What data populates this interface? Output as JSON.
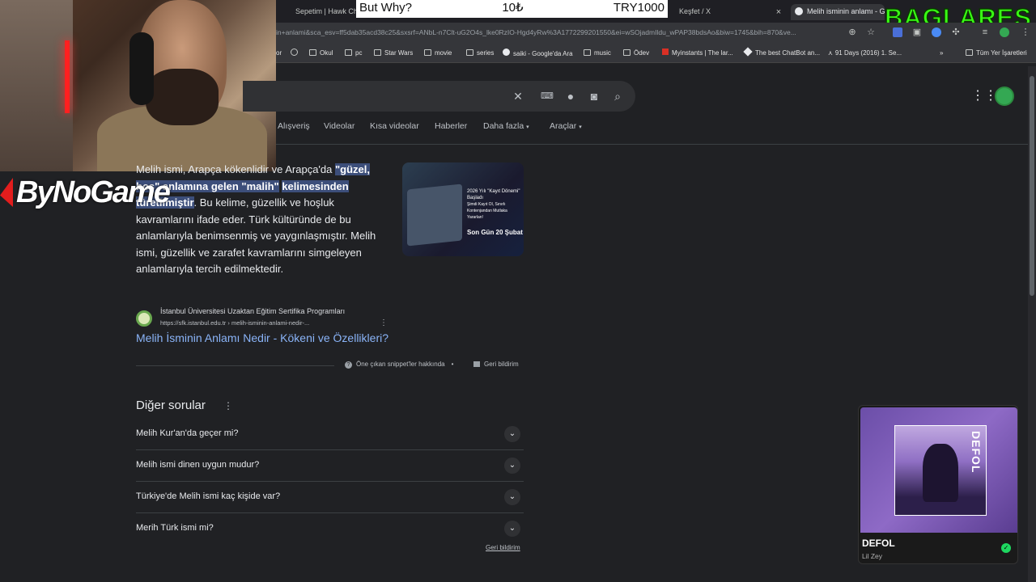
{
  "overlays": {
    "donation_left": "But Why?",
    "donation_mid": "10₺",
    "donation_right": "TRY1000",
    "streamer_tag": "BAGLARES",
    "sponsor_logo": "ByNoGame"
  },
  "tabs": [
    {
      "label": "Sepetim | Hawk Chair"
    },
    {
      "label": "Keşfet / X"
    },
    {
      "label": "Melih isminin anlamı - Google"
    }
  ],
  "address_bar": {
    "url": "in+anlami&sca_esv=ff5dab35acd38c25&sxsrf=ANbL-n7Clt-uG2O4s_lke0RzIO-Hgd4yRw%3A1772299201550&ei=wSOjadmIldu_wPAP38bdsAo&biw=1745&bih=870&ve..."
  },
  "bookmarks": [
    {
      "label": "or"
    },
    {
      "label": "Okul"
    },
    {
      "label": "pc"
    },
    {
      "label": "Star Wars"
    },
    {
      "label": "movie"
    },
    {
      "label": "series"
    },
    {
      "label": "saiki - Google'da Ara"
    },
    {
      "label": "music"
    },
    {
      "label": "Ödev"
    },
    {
      "label": "Myinstants | The lar..."
    },
    {
      "label": "The best ChatBot an..."
    },
    {
      "label": "91 Days (2016) 1. Se..."
    },
    {
      "label": "Tüm Yer İşaretleri"
    }
  ],
  "search_nav": {
    "items": [
      "Alışveriş",
      "Videolar",
      "Kısa videolar",
      "Haberler",
      "Daha fazla",
      "Araçlar"
    ]
  },
  "snippet": {
    "line0": "Melih ismi, Arapça kökenlidir ve Arapça'da",
    "hl1": "\"güzel, hoş\" anlamına gelen \"malih\"",
    "hl2": "kelimesinden türetilmiştir",
    "rest": ". Bu kelime, güzellik ve hoşluk kavramlarını ifade eder. Türk kültüründe de bu anlamlarıyla benimsenmiş ve yaygınlaşmıştır. Melih ismi, güzellik ve zarafet kavramlarını simgeleyen anlamlarıyla tercih edilmektedir."
  },
  "thumbnail": {
    "title_line": "2026 Yılı \"Kayıt Dönemi\" Başladı",
    "sub_line": "Şimdi Kayıt Ol, Sınırlı Kontenjandan Mutlaka Yararlan!",
    "deadline": "Son Gün 20 Şubat"
  },
  "source": {
    "name": "İstanbul Üniversitesi Uzaktan Eğitim Sertifika Programları",
    "url": "https://sfk.istanbul.edu.tr › melih-isminin-anlami-nedir-...",
    "link": "Melih İsminin Anlamı Nedir - Kökeni ve Özellikleri?",
    "about": "Öne çıkan snippet'ler hakkında",
    "feedback": "Geri bildirim"
  },
  "people_also_ask": {
    "title": "Diğer sorular",
    "questions": [
      "Melih Kur'an'da geçer mi?",
      "Melih ismi dinen uygun mudur?",
      "Türkiye'de Melih ismi kaç kişide var?",
      "Merih Türk ismi mi?"
    ],
    "feedback": "Geri bildirim"
  },
  "music_widget": {
    "song": "DEFOL",
    "artist": "Lil Zey",
    "cover_text": "DEFOL"
  },
  "colors": {
    "page_bg": "#202124",
    "link": "#8ab4f8",
    "highlight": "#3c4e7a",
    "streamer_tag": "#39ff14",
    "music_bg": "#8e6ac6"
  }
}
